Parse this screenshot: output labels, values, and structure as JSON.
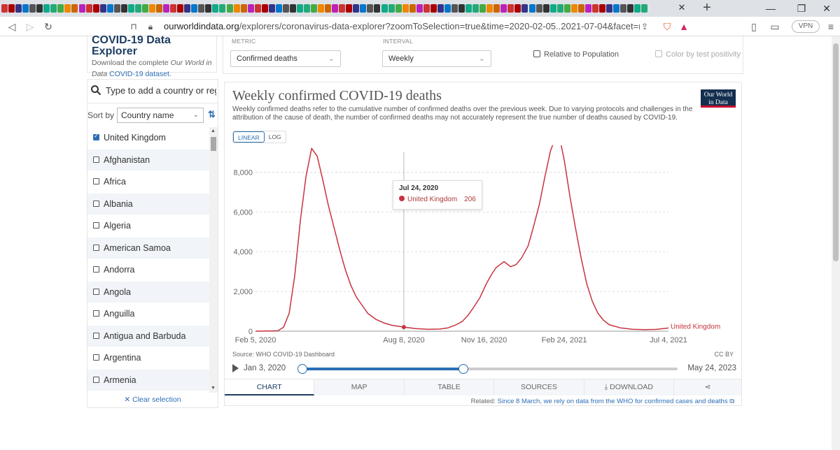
{
  "browser": {
    "url_host": "ourworldindata.org",
    "url_path": "/explorers/coronavirus-data-explorer?zoomToSelection=true&time=2020-02-05..2021-07-04&facet=none&uniformY...",
    "vpn_label": "VPN",
    "tab_close": "✕",
    "tab_new": "+",
    "win_min": "—",
    "win_max": "❐",
    "win_close": "✕"
  },
  "intro": {
    "title": "COVID-19 Data Explorer",
    "text1": "Download the complete",
    "link1": "Our World in Data",
    "link2": "COVID-19 dataset",
    "tail": "."
  },
  "controls": {
    "metric_label": "METRIC",
    "metric_value": "Confirmed deaths",
    "interval_label": "INTERVAL",
    "interval_value": "Weekly",
    "relative_label": "Relative to Population",
    "color_label": "Color by test positivity"
  },
  "sidebar": {
    "search_placeholder": "Type to add a country or region",
    "sort_label": "Sort by",
    "sort_value": "Country name",
    "clear_label": "✕ Clear selection",
    "countries": [
      {
        "name": "United Kingdom",
        "checked": true
      },
      {
        "name": "Afghanistan",
        "checked": false
      },
      {
        "name": "Africa",
        "checked": false
      },
      {
        "name": "Albania",
        "checked": false
      },
      {
        "name": "Algeria",
        "checked": false
      },
      {
        "name": "American Samoa",
        "checked": false
      },
      {
        "name": "Andorra",
        "checked": false
      },
      {
        "name": "Angola",
        "checked": false
      },
      {
        "name": "Anguilla",
        "checked": false
      },
      {
        "name": "Antigua and Barbuda",
        "checked": false
      },
      {
        "name": "Argentina",
        "checked": false
      },
      {
        "name": "Armenia",
        "checked": false
      }
    ]
  },
  "chart": {
    "title": "Weekly confirmed COVID-19 deaths",
    "subtitle": "Weekly confirmed deaths refer to the cumulative number of confirmed deaths over the previous week. Due to varying protocols and challenges in the attribution of the cause of death, the number of confirmed deaths may not accurately represent the true number of deaths caused by COVID-19.",
    "logo_line1": "Our World",
    "logo_line2": "in Data",
    "scale_linear": "LINEAR",
    "scale_log": "LOG",
    "source": "Source: WHO COVID-19 Dashboard",
    "license": "CC BY",
    "tooltip_date": "Jul 24, 2020",
    "tooltip_series": "United Kingdom",
    "tooltip_value": "206",
    "series_color": "#c8333e",
    "timeline_start": "Jan 3, 2020",
    "timeline_end": "May 24, 2023",
    "timeline_range": [
      0.0,
      0.43
    ],
    "tabs": [
      "CHART",
      "MAP",
      "TABLE",
      "SOURCES",
      "⤓ DOWNLOAD",
      "⋖"
    ],
    "related_prefix": "Related:",
    "related_link": "Since 8 March, we rely on data from the WHO for confirmed cases and deaths ⧉"
  },
  "chart_data": {
    "type": "line",
    "title": "Weekly confirmed COVID-19 deaths",
    "ylim": [
      0,
      9000
    ],
    "y_ticks": [
      0,
      2000,
      4000,
      6000,
      8000
    ],
    "y_tick_labels": [
      "0",
      "2,000",
      "4,000",
      "6,000",
      "8,000"
    ],
    "x_tick_labels": [
      "Feb 5, 2020",
      "Aug 8, 2020",
      "Nov 16, 2020",
      "Feb 24, 2021",
      "Jul 4, 2021"
    ],
    "x_tick_days": [
      0,
      185,
      285,
      385,
      515
    ],
    "x_range_days": [
      0,
      515
    ],
    "grid": true,
    "series": [
      {
        "name": "United Kingdom",
        "x_days": [
          0,
          28,
          35,
          42,
          49,
          56,
          63,
          70,
          77,
          84,
          91,
          98,
          105,
          112,
          119,
          126,
          133,
          140,
          150,
          160,
          170,
          185,
          200,
          215,
          230,
          240,
          250,
          258,
          265,
          272,
          280,
          288,
          295,
          300,
          305,
          310,
          318,
          325,
          332,
          340,
          347,
          354,
          361,
          368,
          375,
          380,
          385,
          392,
          399,
          406,
          413,
          420,
          427,
          434,
          441,
          455,
          470,
          485,
          500,
          515
        ],
        "values": [
          0,
          20,
          200,
          900,
          2800,
          5600,
          7800,
          9200,
          8800,
          7600,
          6300,
          5200,
          4100,
          3100,
          2300,
          1700,
          1300,
          900,
          600,
          420,
          300,
          206,
          130,
          100,
          110,
          170,
          320,
          500,
          800,
          1200,
          1700,
          2400,
          2900,
          3200,
          3350,
          3500,
          3250,
          3350,
          3700,
          4300,
          5300,
          6400,
          7800,
          9100,
          9800,
          9600,
          8600,
          6800,
          5200,
          3700,
          2400,
          1500,
          900,
          550,
          330,
          170,
          100,
          80,
          90,
          160
        ]
      }
    ],
    "tooltip_point": {
      "x_day": 185,
      "value": 206
    }
  }
}
